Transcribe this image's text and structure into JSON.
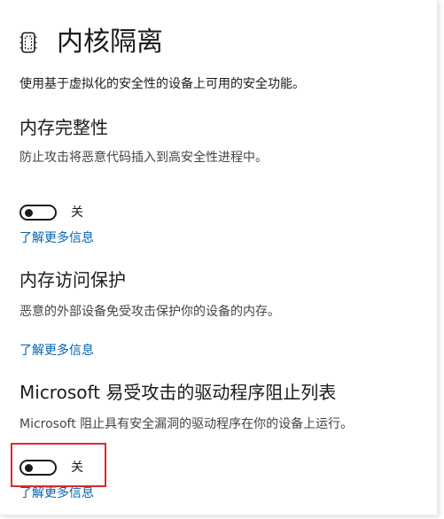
{
  "header": {
    "title": "内核隔离",
    "description": "使用基于虚拟化的安全性的设备上可用的安全功能。"
  },
  "sections": [
    {
      "title": "内存完整性",
      "description": "防止攻击将恶意代码插入到高安全性进程中。",
      "toggle": {
        "state": "off",
        "label": "关"
      },
      "link": "了解更多信息"
    },
    {
      "title": "内存访问保护",
      "description": "恶意的外部设备免受攻击保护你的设备的内存。",
      "link": "了解更多信息"
    },
    {
      "title": "Microsoft 易受攻击的驱动程序阻止列表",
      "description": "Microsoft 阻止具有安全漏洞的驱动程序在你的设备上运行。",
      "toggle": {
        "state": "off",
        "label": "关"
      },
      "link": "了解更多信息"
    }
  ],
  "colors": {
    "link": "#0063b1",
    "highlight": "#e0282a",
    "text": "#1b1b1b"
  },
  "icons": {
    "header": "core-isolation-chip-icon"
  }
}
